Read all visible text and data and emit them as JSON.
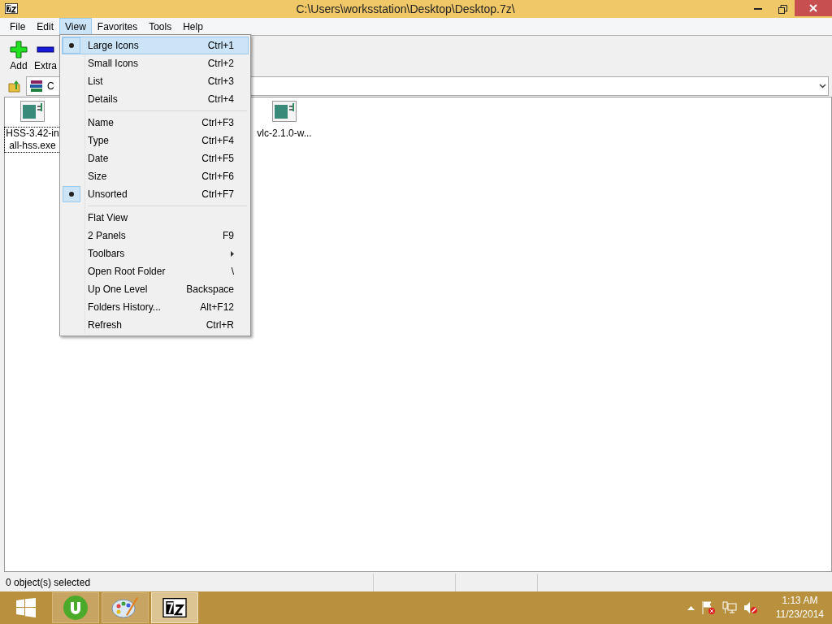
{
  "window": {
    "title": "C:\\Users\\worksstation\\Desktop\\Desktop.7z\\"
  },
  "menu_bar": [
    {
      "label": "File",
      "selected": false
    },
    {
      "label": "Edit",
      "selected": false
    },
    {
      "label": "View",
      "selected": true
    },
    {
      "label": "Favorites",
      "selected": false
    },
    {
      "label": "Tools",
      "selected": false
    },
    {
      "label": "Help",
      "selected": false
    }
  ],
  "toolbar": [
    {
      "kind": "add",
      "label": "Add"
    },
    {
      "kind": "extract",
      "label": "Extra"
    }
  ],
  "address_bar": {
    "value": "C"
  },
  "files": [
    {
      "lines": [
        "HSS-3.42-in",
        "all-hss.exe"
      ],
      "selected": true
    },
    {
      "lines": [
        "vlc-2.1.0-w..."
      ],
      "selected": false
    }
  ],
  "view_menu": [
    {
      "kind": "item",
      "label": "Large Icons",
      "shortcut": "Ctrl+1",
      "checked": true,
      "selected": true
    },
    {
      "kind": "item",
      "label": "Small Icons",
      "shortcut": "Ctrl+2",
      "checked": false,
      "selected": false
    },
    {
      "kind": "item",
      "label": "List",
      "shortcut": "Ctrl+3",
      "checked": false,
      "selected": false
    },
    {
      "kind": "item",
      "label": "Details",
      "shortcut": "Ctrl+4",
      "checked": false,
      "selected": false
    },
    {
      "kind": "separator"
    },
    {
      "kind": "item",
      "label": "Name",
      "shortcut": "Ctrl+F3",
      "checked": false,
      "selected": false
    },
    {
      "kind": "item",
      "label": "Type",
      "shortcut": "Ctrl+F4",
      "checked": false,
      "selected": false
    },
    {
      "kind": "item",
      "label": "Date",
      "shortcut": "Ctrl+F5",
      "checked": false,
      "selected": false
    },
    {
      "kind": "item",
      "label": "Size",
      "shortcut": "Ctrl+F6",
      "checked": false,
      "selected": false
    },
    {
      "kind": "item",
      "label": "Unsorted",
      "shortcut": "Ctrl+F7",
      "checked": true,
      "selected": false
    },
    {
      "kind": "separator"
    },
    {
      "kind": "item",
      "label": "Flat View",
      "checked": false,
      "selected": false
    },
    {
      "kind": "item",
      "label": "2 Panels",
      "shortcut": "F9",
      "checked": false,
      "selected": false
    },
    {
      "kind": "submenu",
      "label": "Toolbars",
      "checked": false,
      "selected": false
    },
    {
      "kind": "item",
      "label": "Open Root Folder",
      "shortcut": "\\",
      "checked": false,
      "selected": false
    },
    {
      "kind": "item",
      "label": "Up One Level",
      "shortcut": "Backspace",
      "checked": false,
      "selected": false
    },
    {
      "kind": "item",
      "label": "Folders History...",
      "shortcut": "Alt+F12",
      "checked": false,
      "selected": false
    },
    {
      "kind": "item",
      "label": "Refresh",
      "shortcut": "Ctrl+R",
      "checked": false,
      "selected": false
    }
  ],
  "status_bar": {
    "text": "0 object(s) selected"
  },
  "taskbar": {
    "apps": [
      {
        "kind": "start",
        "active": false
      },
      {
        "kind": "torrent",
        "active": false
      },
      {
        "kind": "paint",
        "active": false
      },
      {
        "kind": "archiver",
        "active": true
      }
    ],
    "clock": {
      "time": "1:13 AM",
      "date": "11/23/2014"
    }
  }
}
